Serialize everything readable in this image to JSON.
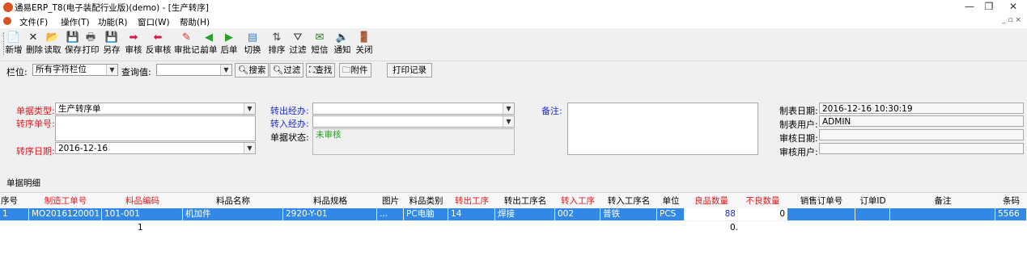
{
  "window": {
    "title": "通易ERP_T8(电子装配行业版)(demo) - [生产转序]",
    "controls": {
      "minimize": "—",
      "maximize": "❐",
      "close": "✕",
      "restore": "_ ▫ ×"
    }
  },
  "menu": {
    "items": [
      "文件(F)",
      "操作(T)",
      "功能(R)",
      "窗口(W)",
      "帮助(H)"
    ]
  },
  "toolbar": {
    "buttons": [
      {
        "label": "新增",
        "icon": "new-doc-icon",
        "glyph": "📄",
        "color": "#3a7bd5"
      },
      {
        "label": "删除",
        "icon": "delete-icon",
        "glyph": "✕",
        "color": "#222222"
      },
      {
        "label": "读取",
        "icon": "open-folder-icon",
        "glyph": "📂",
        "color": "#d99a1c"
      },
      {
        "label": "保存",
        "icon": "save-icon",
        "glyph": "💾",
        "color": "#333333"
      },
      {
        "label": "打印",
        "icon": "print-icon",
        "glyph": "🖶",
        "color": "#555555"
      },
      {
        "label": "另存",
        "icon": "save-as-icon",
        "glyph": "💾",
        "color": "#333333"
      },
      {
        "label": "审核",
        "icon": "approve-arrow-icon",
        "glyph": "➡",
        "color": "#d3184a"
      },
      {
        "label": "反审核",
        "icon": "unapprove-arrow-icon",
        "glyph": "⬅",
        "color": "#d3184a"
      },
      {
        "label": "审批记...",
        "icon": "approval-record-icon",
        "glyph": "✎",
        "color": "#d0302a"
      },
      {
        "label": "前单",
        "icon": "previous-icon",
        "glyph": "◀",
        "color": "#2aa02a"
      },
      {
        "label": "后单",
        "icon": "next-icon",
        "glyph": "▶",
        "color": "#2aa02a"
      },
      {
        "label": "切换",
        "icon": "switch-icon",
        "glyph": "▤",
        "color": "#3a7bd5"
      },
      {
        "label": "排序",
        "icon": "sort-icon",
        "glyph": "⇅",
        "color": "#444444"
      },
      {
        "label": "过滤",
        "icon": "filter-icon",
        "glyph": "⛛",
        "color": "#333333"
      },
      {
        "label": "短信",
        "icon": "sms-icon",
        "glyph": "✉",
        "color": "#2a7a2a"
      },
      {
        "label": "通知",
        "icon": "notify-speaker-icon",
        "glyph": "🔈",
        "color": "#333333"
      },
      {
        "label": "关闭",
        "icon": "close-door-icon",
        "glyph": "🚪",
        "color": "#c46a12"
      }
    ]
  },
  "filter": {
    "column_label": "栏位:",
    "column_value": "所有字符栏位",
    "query_label": "查询值:",
    "query_value": "",
    "buttons": {
      "search": "搜索",
      "filter": "过滤",
      "find": "查找",
      "attach": "附件",
      "print_record": "打印记录"
    }
  },
  "form": {
    "doc_type_label": "单据类型:",
    "doc_type_value": "生产转序单",
    "transfer_no_label": "转序单号:",
    "transfer_no_value": "",
    "transfer_date_label": "转序日期:",
    "transfer_date_value": "2016-12-16",
    "out_handler_label": "转出经办:",
    "out_handler_value": "",
    "in_handler_label": "转入经办:",
    "in_handler_value": "",
    "status_label": "单据状态:",
    "status_value": "未审核",
    "remark_label": "备注:",
    "remark_value": "",
    "created_date_label": "制表日期:",
    "created_date_value": "2016-12-16 10:30:19",
    "created_user_label": "制表用户:",
    "created_user_value": "ADMIN",
    "audit_date_label": "审核日期:",
    "audit_date_value": "",
    "audit_user_label": "审核用户:",
    "audit_user_value": ""
  },
  "grid": {
    "tab_label": "单据明细",
    "columns": [
      "序号",
      "制造工单号",
      "料品编码",
      "料品名称",
      "料品规格",
      "图片",
      "料品类别",
      "转出工序",
      "转出工序名",
      "转入工序",
      "转入工序名",
      "单位",
      "良品数量",
      "不良数量",
      "销售订单号",
      "订单ID",
      "备注",
      "条码"
    ],
    "rows": [
      [
        "1",
        "MO2016120001",
        "101-001",
        "机加件",
        "2920-Y-01",
        "...",
        "PC电脑",
        "14",
        "焊接",
        "002",
        "普铁",
        "PCS",
        "88",
        "0",
        "",
        "",
        "",
        "5566"
      ]
    ],
    "summary": {
      "item_count": "1",
      "good_total": "0."
    }
  },
  "colors": {
    "required_label": "#e0181f",
    "link_label": "#1c2bd8",
    "status_pending": "#1aa61a",
    "selected_row": "#3288e6"
  }
}
